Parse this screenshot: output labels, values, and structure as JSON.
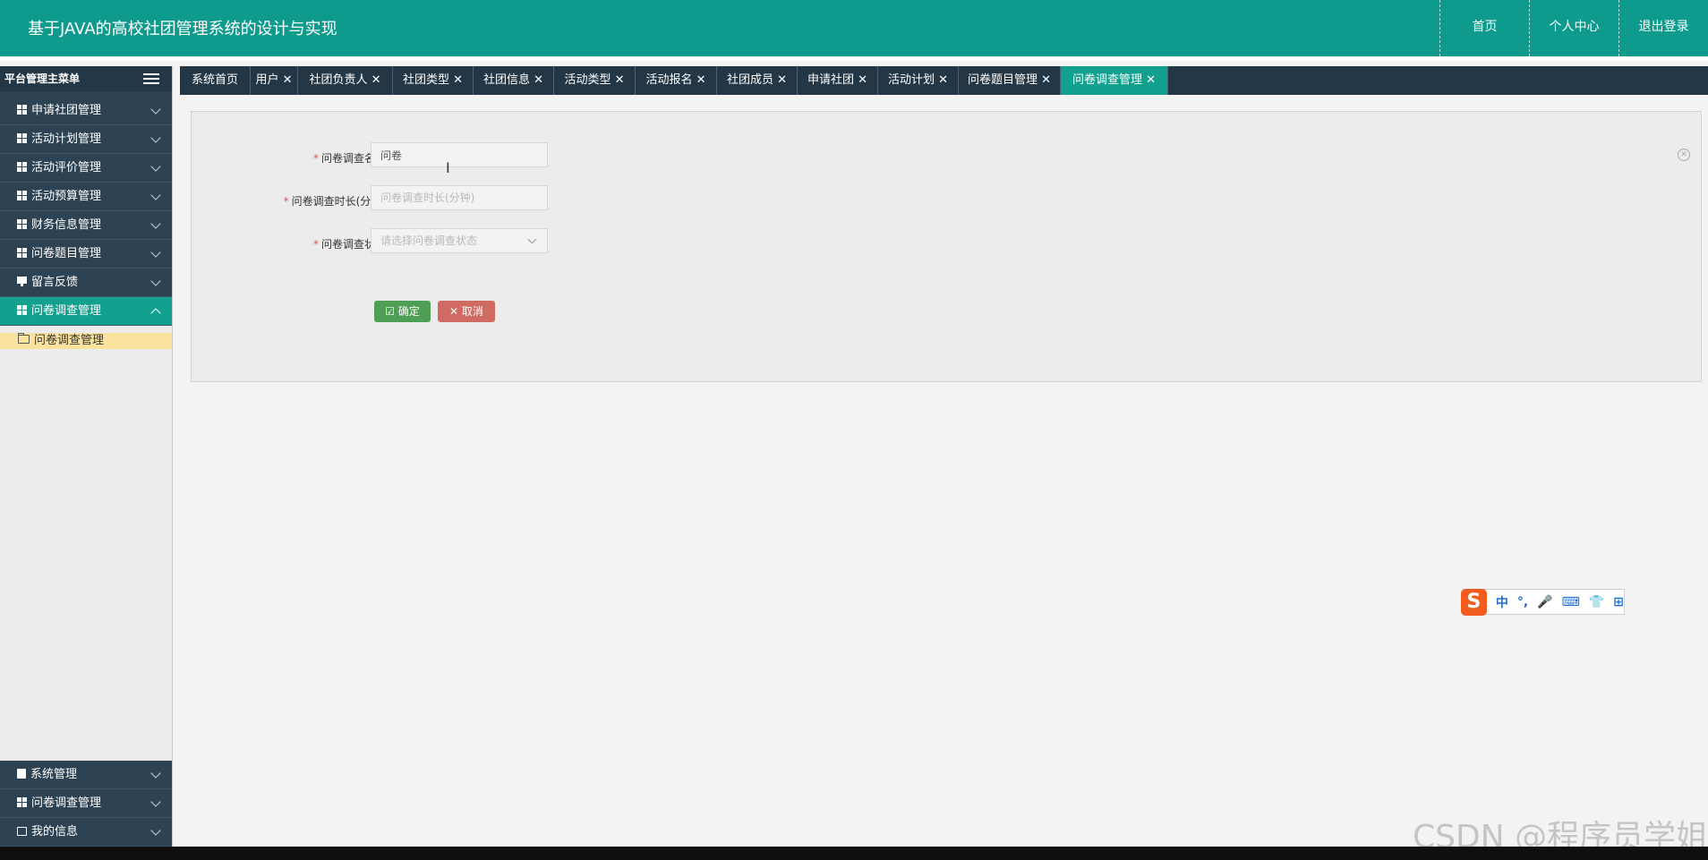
{
  "header": {
    "title": "基于JAVA的高校社团管理系统的设计与实现",
    "nav": [
      "首页",
      "个人中心",
      "退出登录"
    ]
  },
  "sidebar": {
    "heading": "平台管理主菜单",
    "items": [
      {
        "label": "申请社团管理",
        "icon": "grid-icon"
      },
      {
        "label": "活动计划管理",
        "icon": "grid-icon"
      },
      {
        "label": "活动评价管理",
        "icon": "grid-icon"
      },
      {
        "label": "活动预算管理",
        "icon": "grid-icon"
      },
      {
        "label": "财务信息管理",
        "icon": "table-icon"
      },
      {
        "label": "问卷题目管理",
        "icon": "grid-icon"
      },
      {
        "label": "留言反馈",
        "icon": "monitor-icon"
      },
      {
        "label": "问卷调查管理",
        "icon": "grid-icon",
        "active": true
      }
    ],
    "sub_item": "问卷调查管理",
    "bottom_items": [
      {
        "label": "系统管理",
        "icon": "clipboard-icon"
      },
      {
        "label": "问卷调查管理",
        "icon": "grid-icon"
      },
      {
        "label": "我的信息",
        "icon": "card-icon"
      }
    ]
  },
  "tabs": [
    {
      "label": "系统首页"
    },
    {
      "label": "用户 ✕"
    },
    {
      "label": "社团负责人 ✕"
    },
    {
      "label": "社团类型 ✕"
    },
    {
      "label": "社团信息 ✕"
    },
    {
      "label": "活动类型 ✕"
    },
    {
      "label": "活动报名 ✕"
    },
    {
      "label": "社团成员 ✕"
    },
    {
      "label": "申请社团 ✕"
    },
    {
      "label": "活动计划 ✕"
    },
    {
      "label": "问卷题目管理 ✕"
    },
    {
      "label": "问卷调查管理 ✕",
      "active": true
    }
  ],
  "form": {
    "fields": [
      {
        "label": "问卷调查名称",
        "value": "问卷",
        "placeholder": ""
      },
      {
        "label": "问卷调查时长(分钟)",
        "value": "",
        "placeholder": "问卷调查时长(分钟)"
      },
      {
        "label": "问卷调查状态",
        "value": "",
        "placeholder": "请选择问卷调查状态"
      }
    ],
    "required_mark": "*",
    "ok_label": "确定",
    "cancel_label": "取消"
  },
  "ime": {
    "logo": "S",
    "items": [
      "中",
      "°,",
      "🎤",
      "⌨",
      "👕",
      "⊞"
    ]
  },
  "watermark": "CSDN @程序员学姐",
  "colors": {
    "header": "#0e9a8c",
    "sidebar": "#2d4252",
    "active": "#12a08f",
    "ok": "#4e9e55",
    "cancel": "#cf6b62"
  }
}
